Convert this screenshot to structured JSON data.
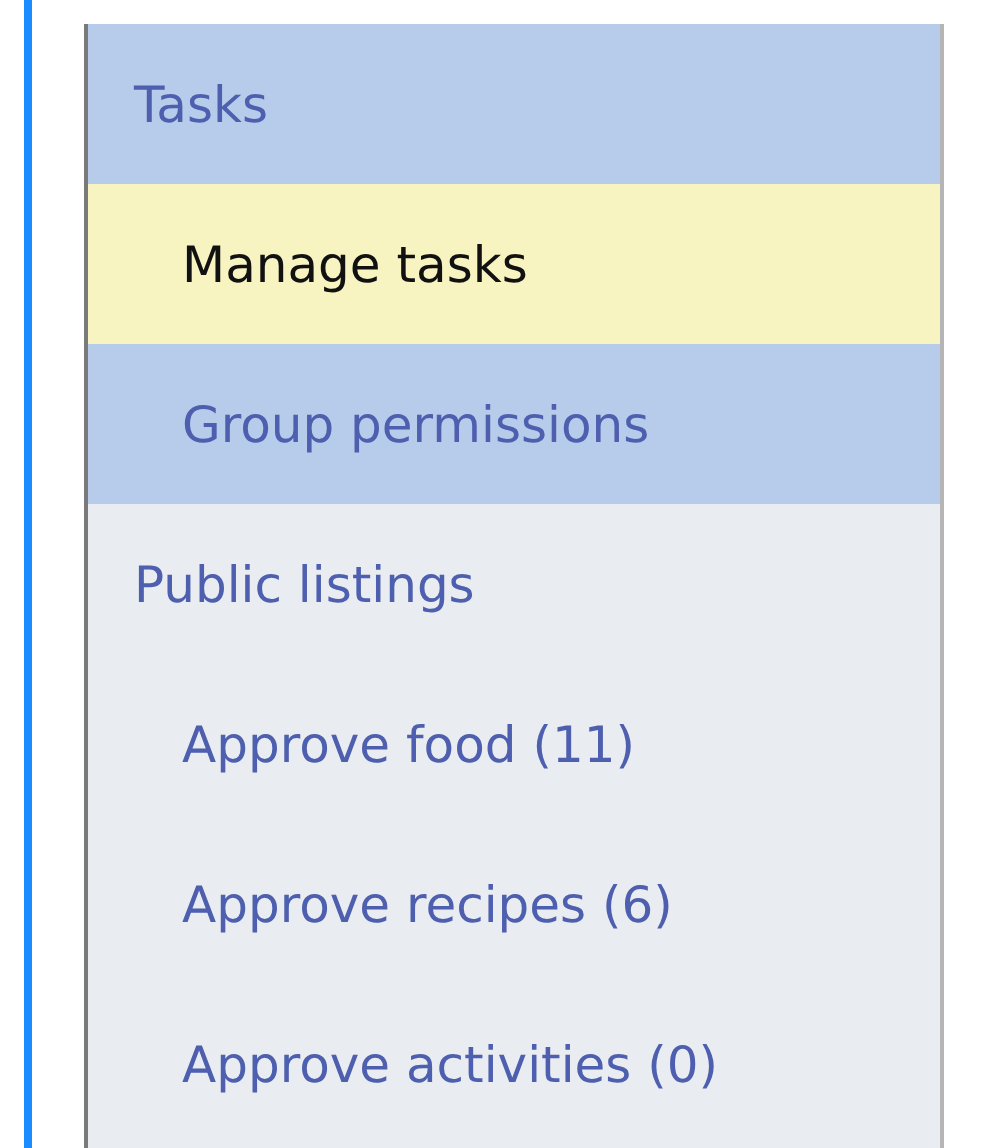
{
  "sections": [
    {
      "title": "Tasks",
      "active": true,
      "items": [
        {
          "label": "Manage tasks",
          "selected": true
        },
        {
          "label": "Group permissions",
          "selected": false
        }
      ]
    },
    {
      "title": "Public listings",
      "active": false,
      "items": [
        {
          "label": "Approve food (11)",
          "selected": false
        },
        {
          "label": "Approve recipes (6)",
          "selected": false
        },
        {
          "label": "Approve activities (0)",
          "selected": false
        }
      ]
    }
  ]
}
